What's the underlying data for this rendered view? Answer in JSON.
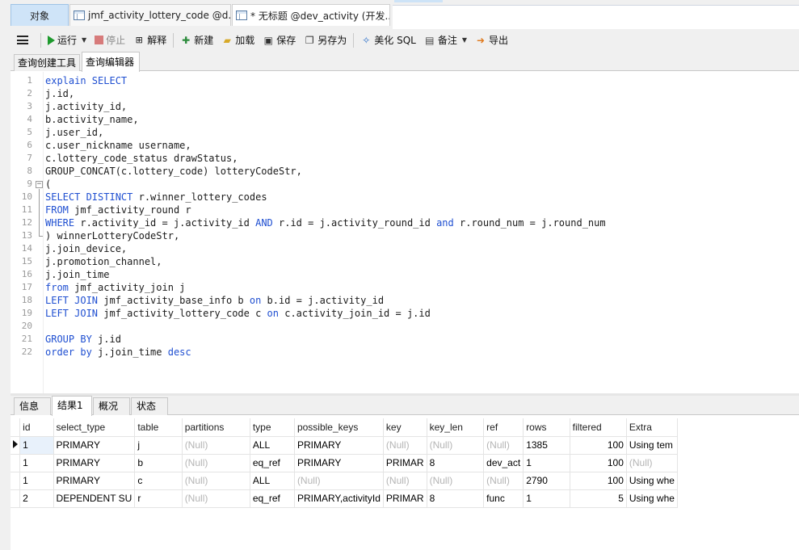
{
  "tabs": {
    "objects": "对象",
    "doc1": "jmf_activity_lottery_code @d...",
    "doc2": "* 无标题 @dev_activity (开发..."
  },
  "toolbar": {
    "run": "运行",
    "stop": "停止",
    "explain": "解释",
    "new": "新建",
    "load": "加载",
    "save": "保存",
    "save_as": "另存为",
    "beautify": "美化 SQL",
    "notes": "备注",
    "export": "导出"
  },
  "subtabs": {
    "builder": "查询创建工具",
    "editor": "查询编辑器"
  },
  "result_tabs": {
    "info": "信息",
    "result": "结果1",
    "overview": "概况",
    "status": "状态"
  },
  "sql_lines": [
    [
      {
        "t": "explain SELECT",
        "k": 1
      }
    ],
    [
      {
        "t": "j.id,"
      }
    ],
    [
      {
        "t": "j.activity_id,"
      }
    ],
    [
      {
        "t": "b.activity_name,"
      }
    ],
    [
      {
        "t": "j.user_id,"
      }
    ],
    [
      {
        "t": "c.user_nickname username,"
      }
    ],
    [
      {
        "t": "c.lottery_code_status drawStatus,"
      }
    ],
    [
      {
        "t": "GROUP_CONCAT(c.lottery_code) lotteryCodeStr,"
      }
    ],
    [
      {
        "t": "("
      }
    ],
    [
      {
        "t": "SELECT DISTINCT",
        "k": 1
      },
      {
        "t": " r.winner_lottery_codes"
      }
    ],
    [
      {
        "t": "FROM",
        "k": 1
      },
      {
        "t": " jmf_activity_round r"
      }
    ],
    [
      {
        "t": "WHERE",
        "k": 1
      },
      {
        "t": " r.activity_id = j.activity_id "
      },
      {
        "t": "AND",
        "k": 1
      },
      {
        "t": " r.id = j.activity_round_id "
      },
      {
        "t": "and",
        "k": 1
      },
      {
        "t": " r.round_num = j.round_num"
      }
    ],
    [
      {
        "t": ") winnerLotteryCodeStr,"
      }
    ],
    [
      {
        "t": "j.join_device,"
      }
    ],
    [
      {
        "t": "j.promotion_channel,"
      }
    ],
    [
      {
        "t": "j.join_time"
      }
    ],
    [
      {
        "t": "from",
        "k": 1
      },
      {
        "t": " jmf_activity_join j"
      }
    ],
    [
      {
        "t": "LEFT JOIN",
        "k": 1
      },
      {
        "t": " jmf_activity_base_info b "
      },
      {
        "t": "on",
        "k": 1
      },
      {
        "t": " b.id = j.activity_id"
      }
    ],
    [
      {
        "t": "LEFT JOIN",
        "k": 1
      },
      {
        "t": " jmf_activity_lottery_code c "
      },
      {
        "t": "on",
        "k": 1
      },
      {
        "t": " c.activity_join_id = j.id"
      }
    ],
    [],
    [
      {
        "t": "GROUP BY",
        "k": 1
      },
      {
        "t": " j.id"
      }
    ],
    [
      {
        "t": "order by",
        "k": 1
      },
      {
        "t": " j.join_time "
      },
      {
        "t": "desc",
        "k": 1
      }
    ]
  ],
  "grid": {
    "columns": [
      "id",
      "select_type",
      "table",
      "partitions",
      "type",
      "possible_keys",
      "key",
      "key_len",
      "ref",
      "rows",
      "filtered",
      "Extra"
    ],
    "rows": [
      [
        "1",
        "PRIMARY",
        "j",
        "(Null)",
        "ALL",
        "PRIMARY",
        "(Null)",
        "(Null)",
        "(Null)",
        "1385",
        "100",
        "Using tem"
      ],
      [
        "1",
        "PRIMARY",
        "b",
        "(Null)",
        "eq_ref",
        "PRIMARY",
        "PRIMAR",
        "8",
        "dev_act",
        "1",
        "100",
        "(Null)"
      ],
      [
        "1",
        "PRIMARY",
        "c",
        "(Null)",
        "ALL",
        "(Null)",
        "(Null)",
        "(Null)",
        "(Null)",
        "2790",
        "100",
        "Using whe"
      ],
      [
        "2",
        "DEPENDENT SU",
        "r",
        "(Null)",
        "eq_ref",
        "PRIMARY,activityId",
        "PRIMAR",
        "8",
        "func",
        "1",
        "5",
        "Using whe"
      ]
    ]
  }
}
